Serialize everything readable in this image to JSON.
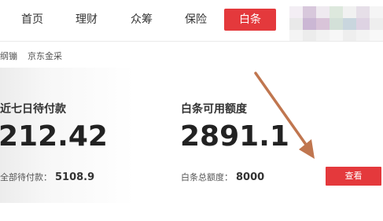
{
  "topnav": {
    "items": [
      "首页",
      "理财",
      "众筹",
      "保险"
    ],
    "active_label": "白条",
    "active_color": "#e4393c"
  },
  "subnav": {
    "items": [
      "纲镚",
      "京东金采"
    ]
  },
  "panel": {
    "seven_day": {
      "label": "近七日待付款",
      "value": "212.42",
      "sub_label": "全部待付款：",
      "sub_value": "5108.9"
    },
    "available": {
      "label": "白条可用额度",
      "value": "2891.1",
      "sub_label": "白条总额度：",
      "sub_value": "8000"
    },
    "view_button": "查看"
  },
  "annotation": {
    "arrow_color": "#c0764f",
    "arrow-icon": "arrow-icon"
  }
}
